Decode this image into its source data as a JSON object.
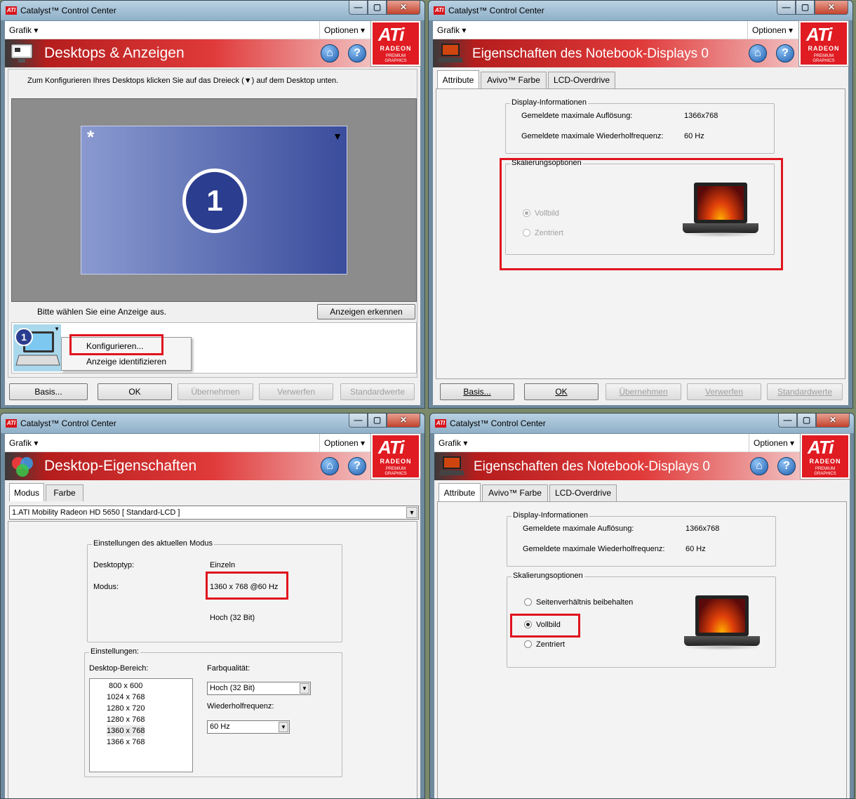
{
  "app_title": "Catalyst™ Control Center",
  "menu": {
    "grafik": "Grafik",
    "optionen": "Optionen"
  },
  "ati_logo": {
    "brand": "ATi",
    "line1": "RADEON",
    "line2": "PREMIUM",
    "line3": "GRAPHICS"
  },
  "window_buttons": {
    "minimize": "—",
    "maximize": "▢",
    "close": "✕"
  },
  "colors": {
    "ati_red": "#e01b22",
    "highlight_red": "#e0141e",
    "desktop_blue": "#3a4c9c"
  },
  "w1": {
    "heading": "Desktops & Anzeigen",
    "instruction": "Zum Konfigurieren Ihres Desktops klicken Sie auf das Dreieck (▼) auf dem Desktop unten.",
    "desktop_star": "*",
    "desktop_number": "1",
    "select_prompt": "Bitte wählen Sie eine Anzeige aus.",
    "detect_button": "Anzeigen erkennen",
    "thumb_number": "1",
    "context_menu": [
      "Konfigurieren...",
      "Anzeige identifizieren"
    ],
    "buttons": [
      "Basis...",
      "OK",
      "Übernehmen",
      "Verwerfen",
      "Standardwerte"
    ]
  },
  "w2": {
    "heading": "Eigenschaften des Notebook-Displays 0",
    "tabs": [
      "Attribute",
      "Avivo™ Farbe",
      "LCD-Overdrive"
    ],
    "display_info": {
      "legend": "Display-Informationen",
      "rows": [
        {
          "label": "Gemeldete maximale Auflösung:",
          "value": "1366x768"
        },
        {
          "label": "Gemeldete maximale Wiederholfrequenz:",
          "value": "60 Hz"
        }
      ]
    },
    "scaling": {
      "legend": "Skalierungsoptionen",
      "options": [
        "Vollbild",
        "Zentriert"
      ],
      "selected": "Vollbild"
    },
    "buttons": [
      "Basis...",
      "OK",
      "Übernehmen",
      "Verwerfen",
      "Standardwerte"
    ]
  },
  "w3": {
    "heading": "Desktop-Eigenschaften",
    "tabs": [
      "Modus",
      "Farbe"
    ],
    "adapter": "1.ATI Mobility Radeon HD 5650 [ Standard-LCD ]",
    "current_mode": {
      "legend": "Einstellungen des aktuellen Modus",
      "desktop_type_label": "Desktoptyp:",
      "desktop_type_value": "Einzeln",
      "mode_label": "Modus:",
      "mode_value": "1360 x 768 @60 Hz",
      "depth_value": "Hoch (32 Bit)"
    },
    "settings": {
      "legend": "Einstellungen:",
      "area_label": "Desktop-Bereich:",
      "resolutions": [
        "800 x 600",
        "1024 x 768",
        "1280 x 720",
        "1280 x 768",
        "1360 x 768",
        "1366 x 768"
      ],
      "selected_resolution": "1360 x 768",
      "color_quality_label": "Farbqualität:",
      "color_quality_value": "Hoch (32 Bit)",
      "refresh_label": "Wiederholfrequenz:",
      "refresh_value": "60 Hz"
    }
  },
  "w4": {
    "heading": "Eigenschaften des Notebook-Displays 0",
    "tabs": [
      "Attribute",
      "Avivo™ Farbe",
      "LCD-Overdrive"
    ],
    "display_info": {
      "legend": "Display-Informationen",
      "rows": [
        {
          "label": "Gemeldete maximale Auflösung:",
          "value": "1366x768"
        },
        {
          "label": "Gemeldete maximale Wiederholfrequenz:",
          "value": "60 Hz"
        }
      ]
    },
    "scaling": {
      "legend": "Skalierungsoptionen",
      "options": [
        "Seitenverhältnis beibehalten",
        "Vollbild",
        "Zentriert"
      ],
      "selected": "Vollbild"
    }
  }
}
